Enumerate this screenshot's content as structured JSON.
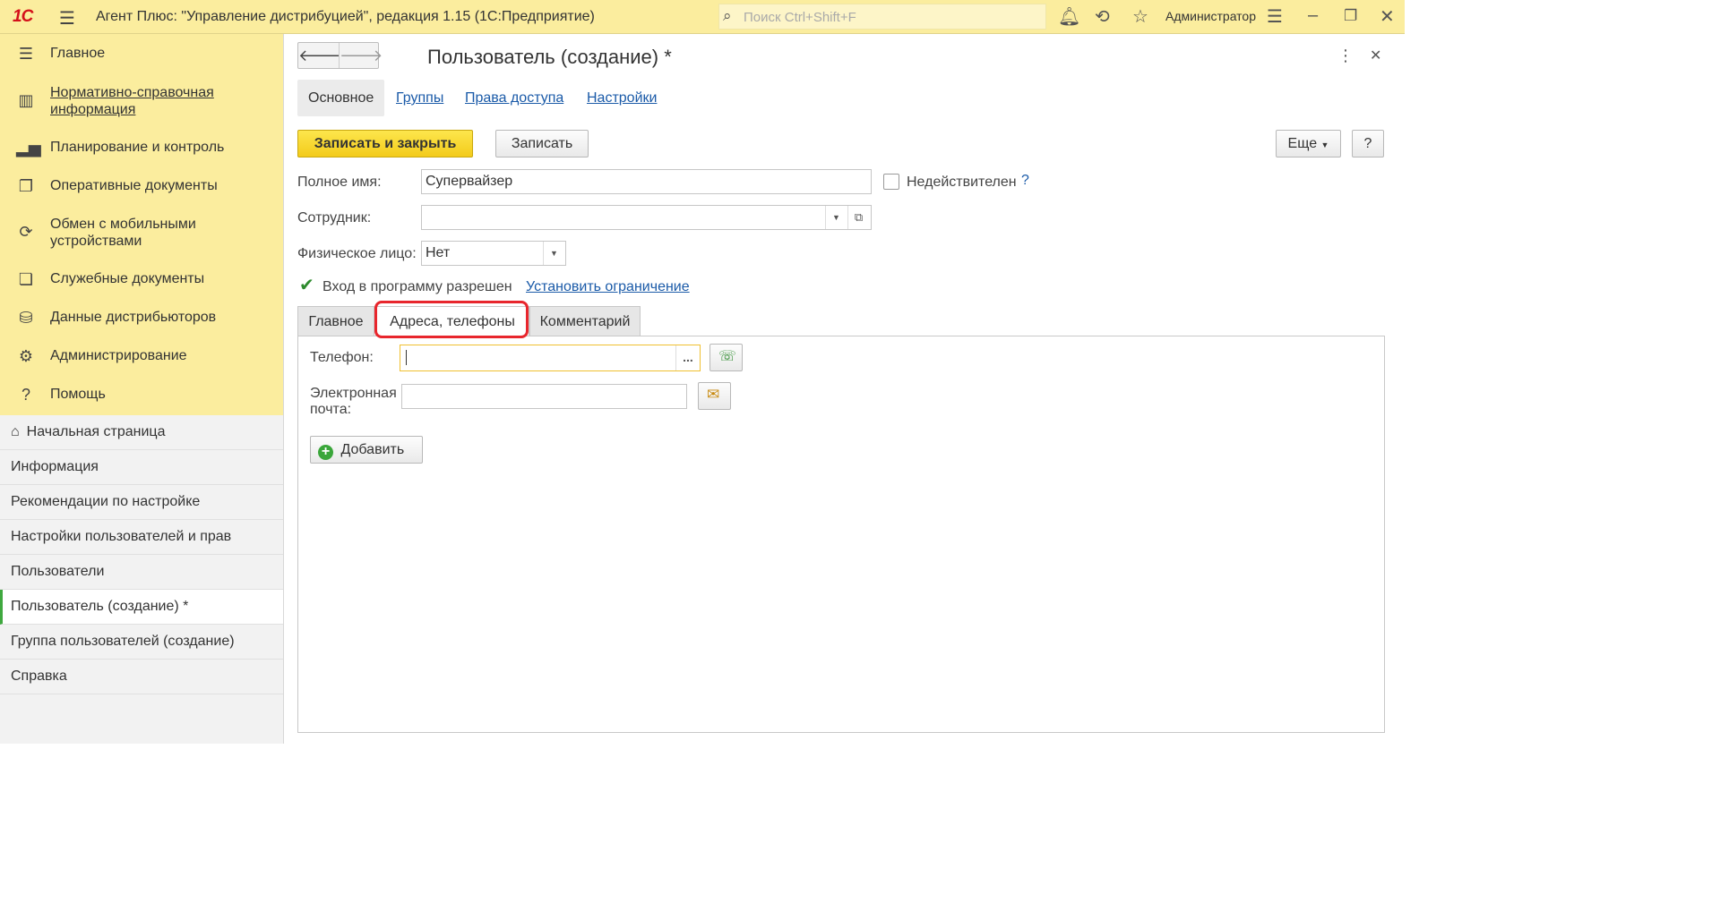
{
  "titlebar": {
    "logo": "1С",
    "menu_icon": "hamburger-icon",
    "app_title": "Агент Плюс: \"Управление дистрибуцией\", редакция 1.15  (1С:Предприятие)",
    "search_placeholder": "Поиск Ctrl+Shift+F",
    "user": "Администратор"
  },
  "sidebar": {
    "nav": [
      {
        "label": "Главное",
        "icon": "menu-list-icon"
      },
      {
        "label": "Нормативно-справочная информация",
        "icon": "books-icon"
      },
      {
        "label": "Планирование и контроль",
        "icon": "bar-chart-icon"
      },
      {
        "label": "Оперативные документы",
        "icon": "documents-icon"
      },
      {
        "label": "Обмен с мобильными устройствами",
        "icon": "sync-icon"
      },
      {
        "label": "Служебные документы",
        "icon": "service-docs-icon"
      },
      {
        "label": "Данные дистрибьюторов",
        "icon": "distributor-icon"
      },
      {
        "label": "Администрирование",
        "icon": "gear-icon"
      },
      {
        "label": "Помощь",
        "icon": "question-icon"
      }
    ],
    "open_windows": [
      {
        "label": "Начальная страница"
      },
      {
        "label": "Информация"
      },
      {
        "label": "Рекомендации по настройке"
      },
      {
        "label": "Настройки пользователей и прав"
      },
      {
        "label": "Пользователи"
      },
      {
        "label": "Пользователь (создание) *"
      },
      {
        "label": "Группа пользователей (создание)"
      },
      {
        "label": "Справка"
      }
    ]
  },
  "form": {
    "title": "Пользователь (создание) *",
    "tabs": [
      "Основное",
      "Группы",
      "Права доступа",
      "Настройки"
    ],
    "save_close": "Записать и закрыть",
    "save": "Записать",
    "more": "Еще",
    "help": "?",
    "full_name_label": "Полное имя:",
    "full_name_value": "Супервайзер",
    "invalid_label": "Недействителен",
    "invalid_help": "?",
    "employee_label": "Сотрудник:",
    "employee_value": "",
    "person_label": "Физическое лицо:",
    "person_value": "Нет",
    "login_allowed_label": "Вход в программу разрешен",
    "set_restriction": "Установить ограничение",
    "page_tabs": [
      "Главное",
      "Адреса, телефоны",
      "Комментарий"
    ],
    "phone_label": "Телефон:",
    "phone_value": "",
    "phone_more": "...",
    "email_label_1": "Электронная",
    "email_label_2": "почта:",
    "email_value": "",
    "add_button": "Добавить"
  }
}
